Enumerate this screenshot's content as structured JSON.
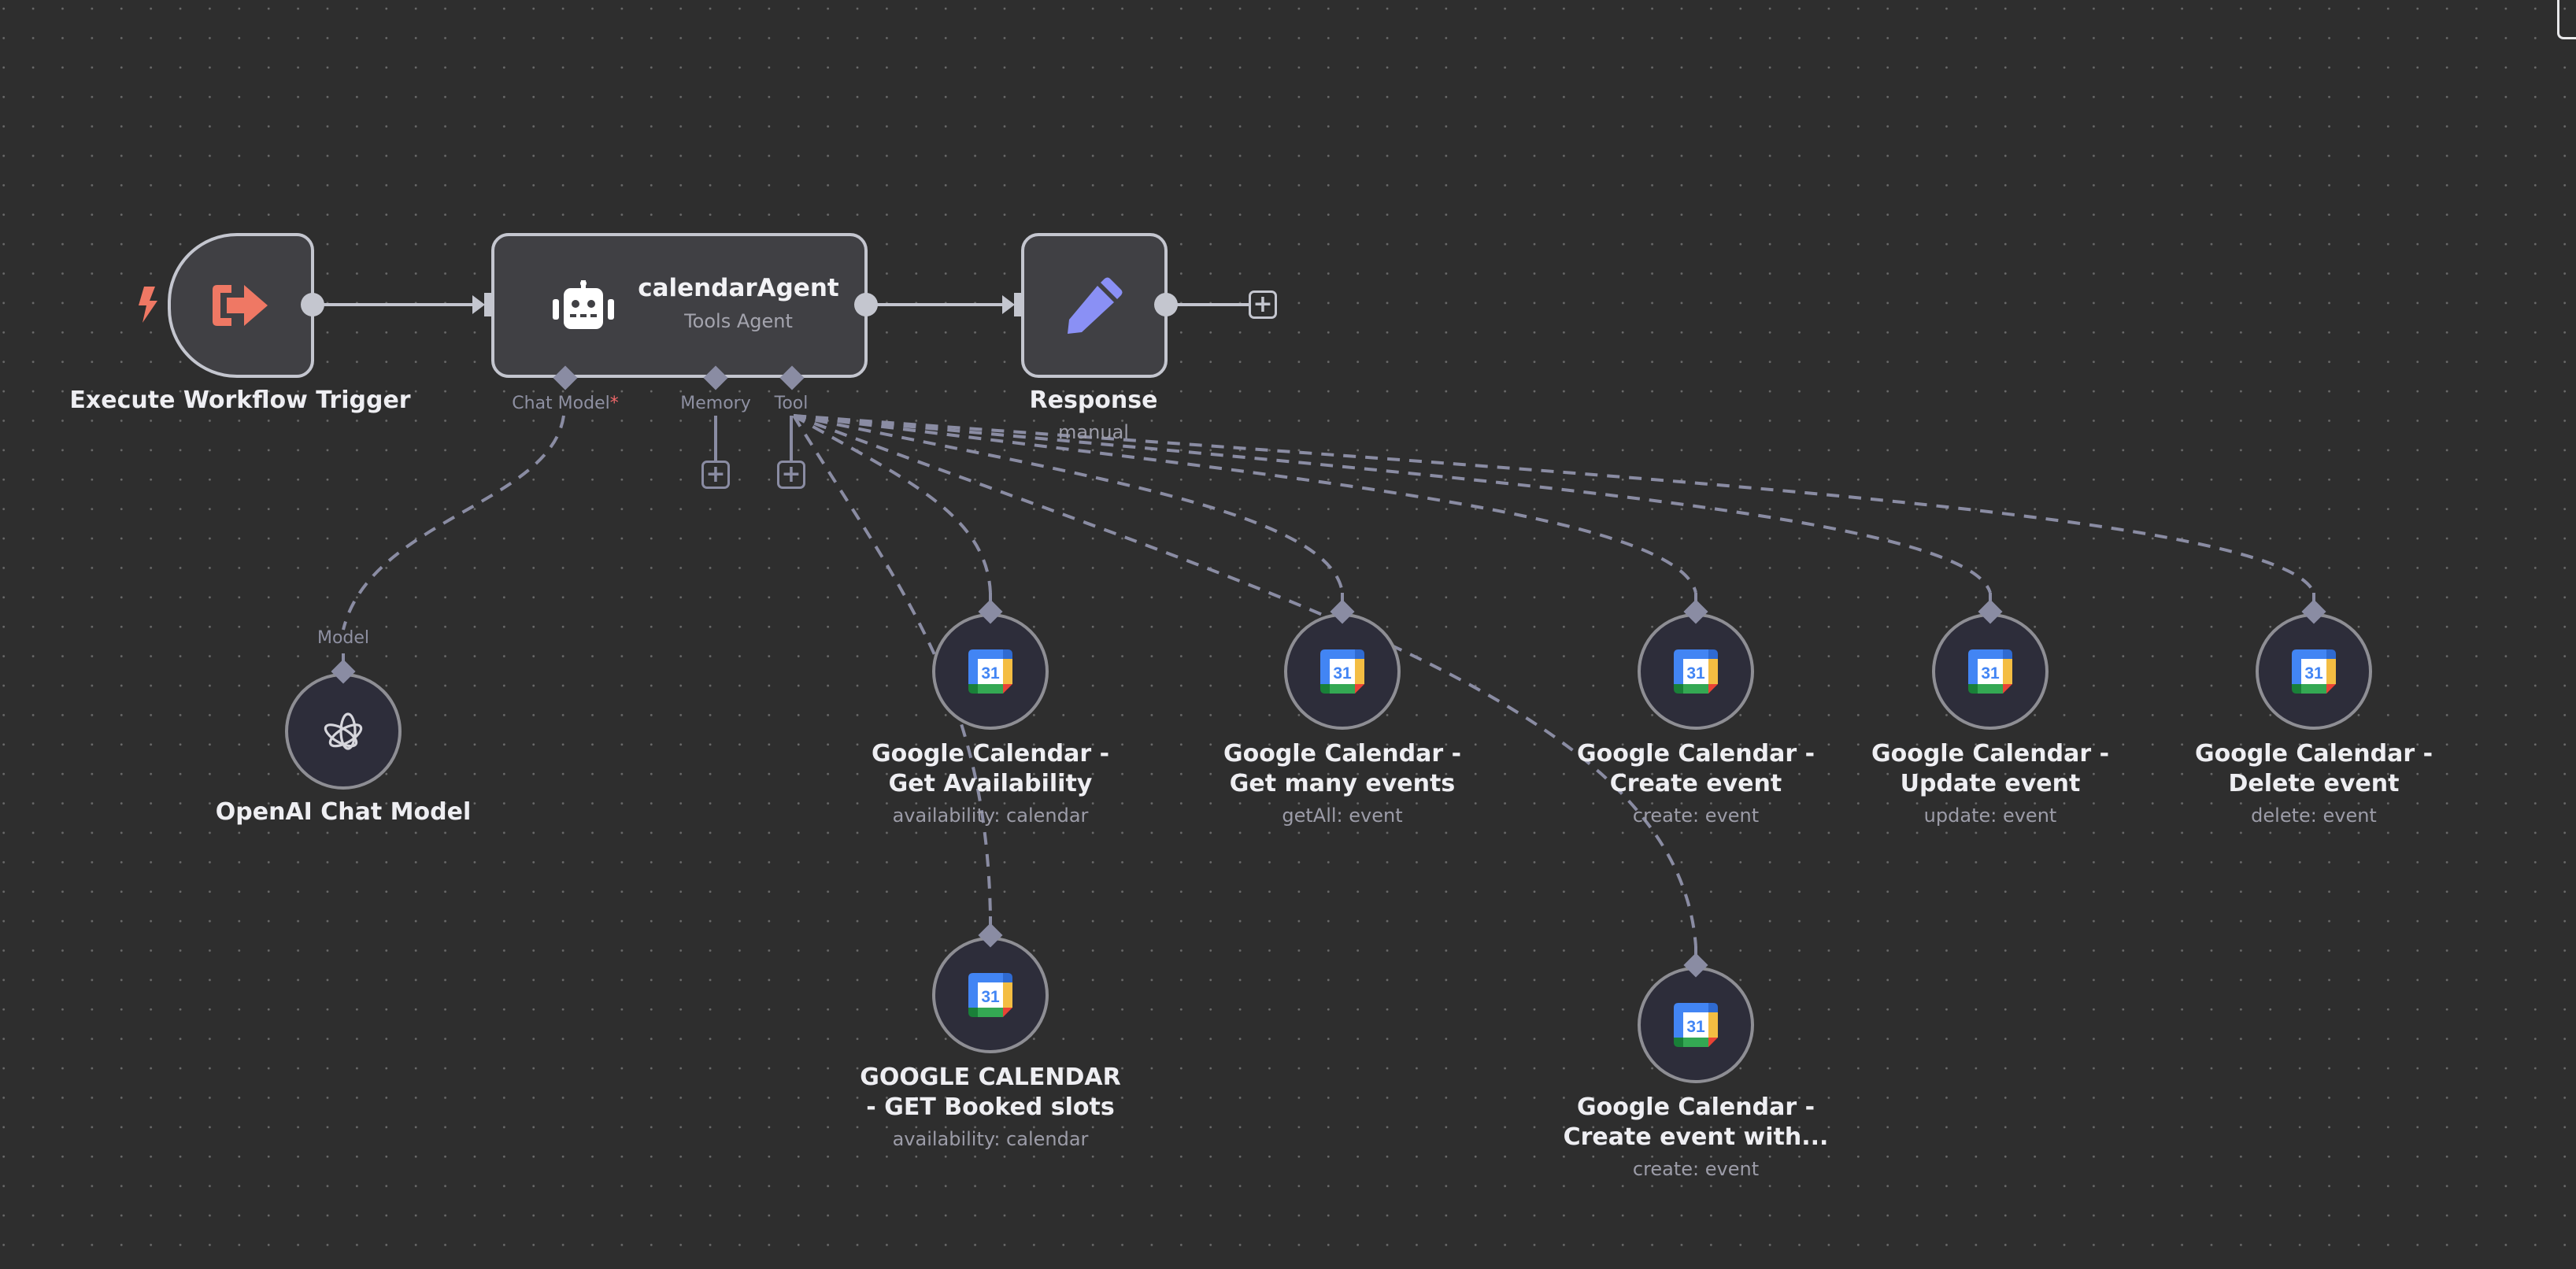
{
  "canvas": {
    "background": "#2e2e2e",
    "edge_color": "#c4c6cf",
    "sub_edge_color": "#8a8ca3",
    "accent_trigger": "#ef7864",
    "accent_pencil": "#8a90f5"
  },
  "nodes": {
    "trigger": {
      "title": "Execute Workflow Trigger",
      "icon": "sign-in-arrow-icon",
      "badge_icon": "lightning-bolt-icon"
    },
    "agent": {
      "title": "calendarAgent",
      "subtitle": "Tools Agent",
      "icon": "robot-icon",
      "ports": {
        "chat_model": "Chat Model",
        "required_mark": "*",
        "memory": "Memory",
        "tool": "Tool"
      }
    },
    "response": {
      "title": "Response",
      "subtitle": "manual",
      "icon": "pencil-icon"
    },
    "openai": {
      "title": "OpenAI Chat Model",
      "port": "Model",
      "icon": "openai-logo-icon"
    },
    "tools": [
      {
        "title_line1": "Google Calendar -",
        "title_line2": "Get Availability",
        "subtitle": "availability: calendar",
        "icon": "google-calendar-icon"
      },
      {
        "title_line1": "Google Calendar -",
        "title_line2": "Get many events",
        "subtitle": "getAll: event",
        "icon": "google-calendar-icon"
      },
      {
        "title_line1": "Google Calendar -",
        "title_line2": "Create event",
        "subtitle": "create: event",
        "icon": "google-calendar-icon"
      },
      {
        "title_line1": "Google Calendar -",
        "title_line2": "Update event",
        "subtitle": "update: event",
        "icon": "google-calendar-icon"
      },
      {
        "title_line1": "Google Calendar -",
        "title_line2": "Delete event",
        "subtitle": "delete: event",
        "icon": "google-calendar-icon"
      },
      {
        "title_line1": "GOOGLE CALENDAR",
        "title_line2": "- GET Booked slots",
        "subtitle": "availability: calendar",
        "icon": "google-calendar-icon"
      },
      {
        "title_line1": "Google Calendar -",
        "title_line2": "Create event with...",
        "subtitle": "create: event",
        "icon": "google-calendar-icon"
      }
    ]
  },
  "gcal_icon": {
    "day": "31"
  },
  "plus_symbol": "+"
}
